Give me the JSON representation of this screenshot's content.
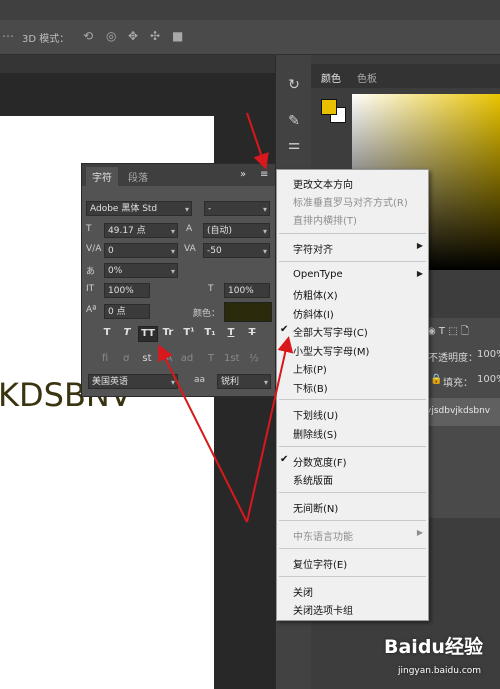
{
  "optionsbar": {
    "mode_3d_label": "3D 模式："
  },
  "right_panel": {
    "tab_color": "颜色",
    "tab_swatches": "色板",
    "opacity_label": "不透明度：",
    "opacity_value": "100%",
    "fill_label": "填充：",
    "fill_value": "100%",
    "layer_name": "vjsdbvjkdsbnv"
  },
  "canvas": {
    "text": "KDSBNV"
  },
  "character_panel": {
    "tab_character": "字符",
    "tab_paragraph": "段落",
    "font_family": "Adobe 黑体 Std",
    "font_style": "-",
    "font_size": "49.17 点",
    "leading": "(自动)",
    "kerning": "0",
    "tracking": "-50",
    "tsume": "0%",
    "vertical_scale": "100%",
    "horizontal_scale": "100%",
    "baseline_shift": "0 点",
    "color_label": "颜色：",
    "language": "美国英语",
    "aa_label": "aa",
    "antialias": "锐利",
    "type_buttons": [
      "T",
      "T",
      "TT",
      "Tr",
      "T¹",
      "T₁",
      "T",
      "T"
    ],
    "opentype_buttons": [
      "fi",
      "ơ",
      "st",
      "A",
      "ad",
      "T",
      "1st",
      "½"
    ]
  },
  "menu": {
    "items": [
      {
        "label": "更改文本方向"
      },
      {
        "label": "标准垂直罗马对齐方式(R)",
        "disabled": true
      },
      {
        "label": "直排内横排(T)",
        "disabled": true
      },
      {
        "label": "字符对齐",
        "submenu": true
      },
      {
        "label": "OpenType",
        "submenu": true
      },
      {
        "label": "仿粗体(X)"
      },
      {
        "label": "仿斜体(I)"
      },
      {
        "label": "全部大写字母(C)",
        "checked": true
      },
      {
        "label": "小型大写字母(M)"
      },
      {
        "label": "上标(P)"
      },
      {
        "label": "下标(B)"
      },
      {
        "label": "下划线(U)"
      },
      {
        "label": "删除线(S)"
      },
      {
        "label": "分数宽度(F)",
        "checked": true
      },
      {
        "label": "系统版面"
      },
      {
        "label": "无间断(N)"
      },
      {
        "label": "中东语言功能",
        "disabled": true,
        "submenu": true
      },
      {
        "label": "复位字符(E)"
      },
      {
        "label": "关闭"
      },
      {
        "label": "关闭选项卡组"
      }
    ]
  },
  "watermark": {
    "brand": "Baidu经验",
    "url": "jingyan.baidu.com"
  },
  "colors": {
    "annotation_arrow": "#d8181c",
    "text_color": "#2b2a0b",
    "foreground": "#e8c000"
  }
}
